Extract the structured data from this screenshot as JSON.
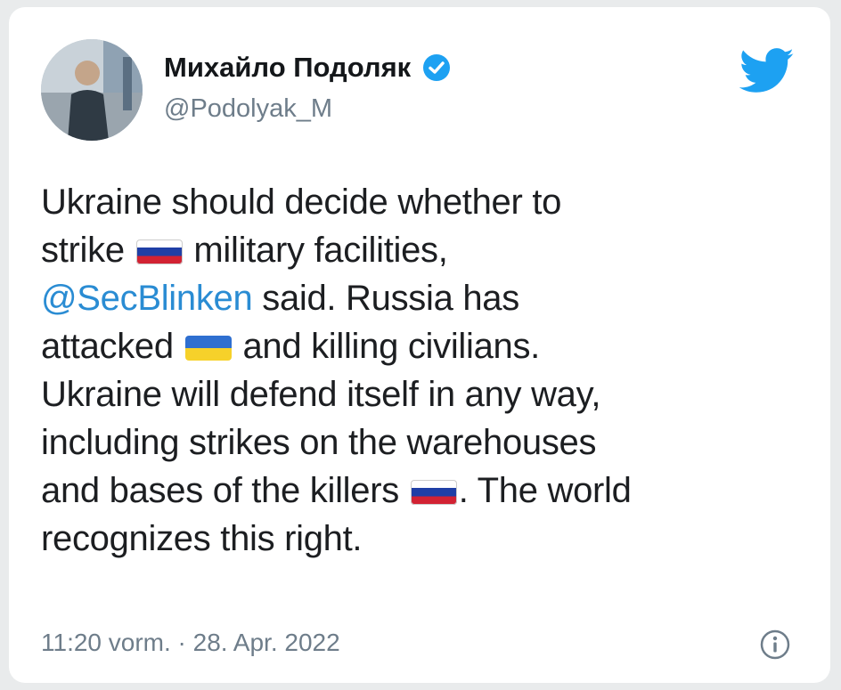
{
  "tweet": {
    "author_name": "Михайло Подоляк",
    "author_handle": "@Podolyak_M",
    "lines": [
      [
        "Ukraine should decide whether to"
      ],
      [
        "strike ",
        " military facilities,"
      ],
      [
        "@SecBlinken",
        " said. Russia has"
      ],
      [
        "attacked ",
        " and killing civilians."
      ],
      [
        "Ukraine will defend itself in any way,"
      ],
      [
        "including strikes on the warehouses"
      ],
      [
        "and bases of the killers ",
        ". The world"
      ],
      [
        "recognizes this right."
      ]
    ],
    "timestamp": "11:20 vorm. · 28. Apr. 2022"
  },
  "icons": {
    "verified": "verified-badge-icon",
    "brand": "twitter-bird-icon",
    "info": "info-icon",
    "flag_russia": "russia-flag-icon",
    "flag_ukraine": "ukraine-flag-icon"
  },
  "colors": {
    "brand": "#1da1f2",
    "mention": "#2a8cd3",
    "text": "#1c1e21",
    "muted": "#6e7d8a"
  }
}
